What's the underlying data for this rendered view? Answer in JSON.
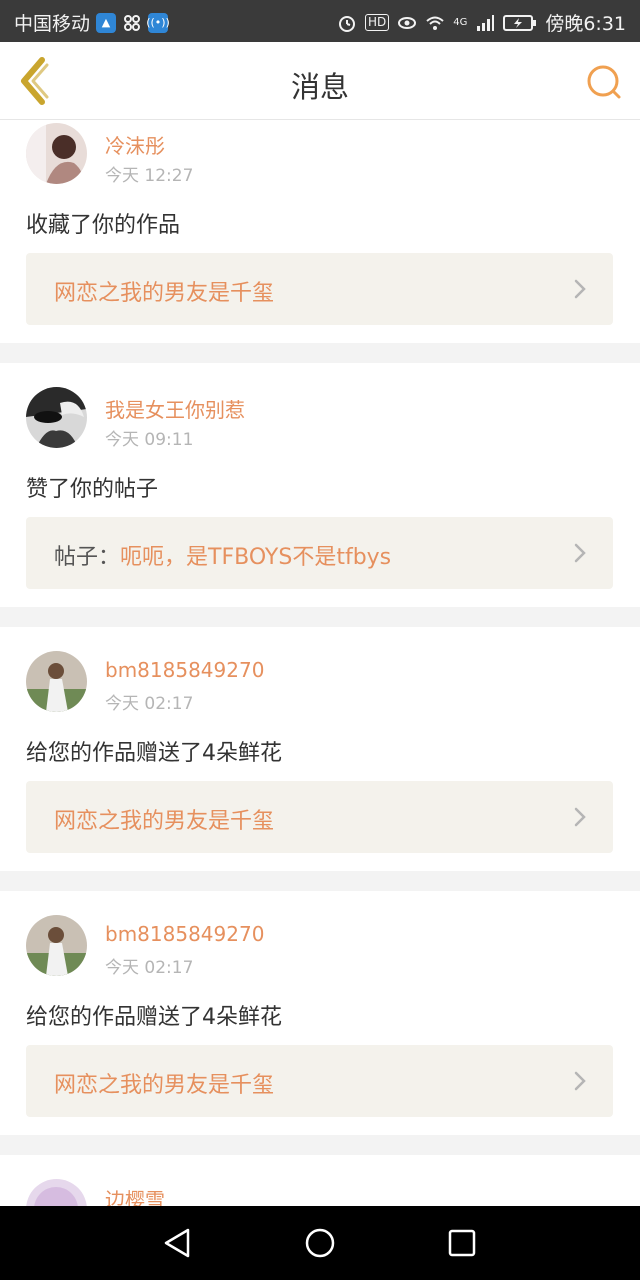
{
  "status_bar": {
    "carrier": "中国移动",
    "time": "傍晚6:31",
    "hd_label": "HD",
    "network_label": "4G"
  },
  "header": {
    "title": "消息"
  },
  "messages": [
    {
      "username": "冷沫彤",
      "time": "今天 12:27",
      "action": "收藏了你的作品",
      "link_prefix": "",
      "link_text": "网恋之我的男友是千玺"
    },
    {
      "username": "我是女王你别惹",
      "time": "今天 09:11",
      "action": "赞了你的帖子",
      "link_prefix": "帖子：",
      "link_text": "呃呃，是TFBOYS不是tfbys"
    },
    {
      "username": "bm8185849270",
      "time": "今天 02:17",
      "action": "给您的作品赠送了4朵鲜花",
      "link_prefix": "",
      "link_text": "网恋之我的男友是千玺"
    },
    {
      "username": "bm8185849270",
      "time": "今天 02:17",
      "action": "给您的作品赠送了4朵鲜花",
      "link_prefix": "",
      "link_text": "网恋之我的男友是千玺"
    },
    {
      "username": "边樱雪"
    }
  ],
  "colors": {
    "accent": "#e6905e",
    "back_arrow": "#c9a52e",
    "link_bg": "#f4f2ec"
  },
  "icons": {
    "back": "chevron-left-icon",
    "search": "search-icon",
    "link_arrow": "chevron-right-icon",
    "nav_back": "triangle-back-icon",
    "nav_home": "circle-home-icon",
    "nav_recent": "square-recent-icon"
  }
}
